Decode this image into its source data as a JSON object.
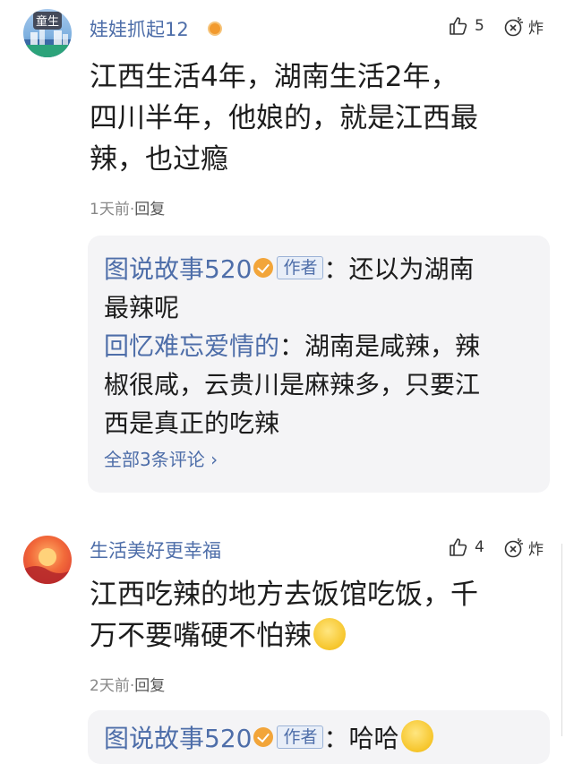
{
  "comments": [
    {
      "username": "娃娃抓起12",
      "avatar_text": "童生",
      "likes": "5",
      "bomb_label": "炸",
      "text_lines": [
        "江西生活4年，湖南生活2年，",
        "四川半年，他娘的，就是江西最",
        "辣，也过瘾"
      ],
      "time": "1天前",
      "dot": "·",
      "reply_label": "回复",
      "replies": [
        {
          "name": "图说故事520",
          "author_tag": "作者",
          "sep": "：",
          "lines": [
            "还以为湖南",
            "最辣呢"
          ]
        },
        {
          "name": "回忆难忘爱情的",
          "sep": "：",
          "lines": [
            "湖南是咸辣，辣",
            "椒很咸，云贵川是麻辣多，只要江",
            "西是真正的吃辣"
          ]
        }
      ],
      "see_all": "全部3条评论 ›"
    },
    {
      "username": "生活美好更幸福",
      "likes": "4",
      "bomb_label": "炸",
      "text_lines": [
        "江西吃辣的地方去饭馆吃饭，千",
        "万不要嘴硬不怕辣"
      ],
      "time": "2天前",
      "dot": "·",
      "reply_label": "回复",
      "partial_reply": {
        "name": "图说故事520",
        "author_tag": "作者",
        "sep": "：",
        "text": "哈哈"
      }
    }
  ],
  "colors": {
    "link_blue": "#4e6ea9",
    "meta_gray": "#888888",
    "card_bg": "#f4f4f6"
  },
  "icons": {
    "like": "thumbs-up-icon",
    "bomb": "bomb-icon",
    "badge": "verified-badge-icon",
    "emoji": "grinning-emoji-icon"
  }
}
